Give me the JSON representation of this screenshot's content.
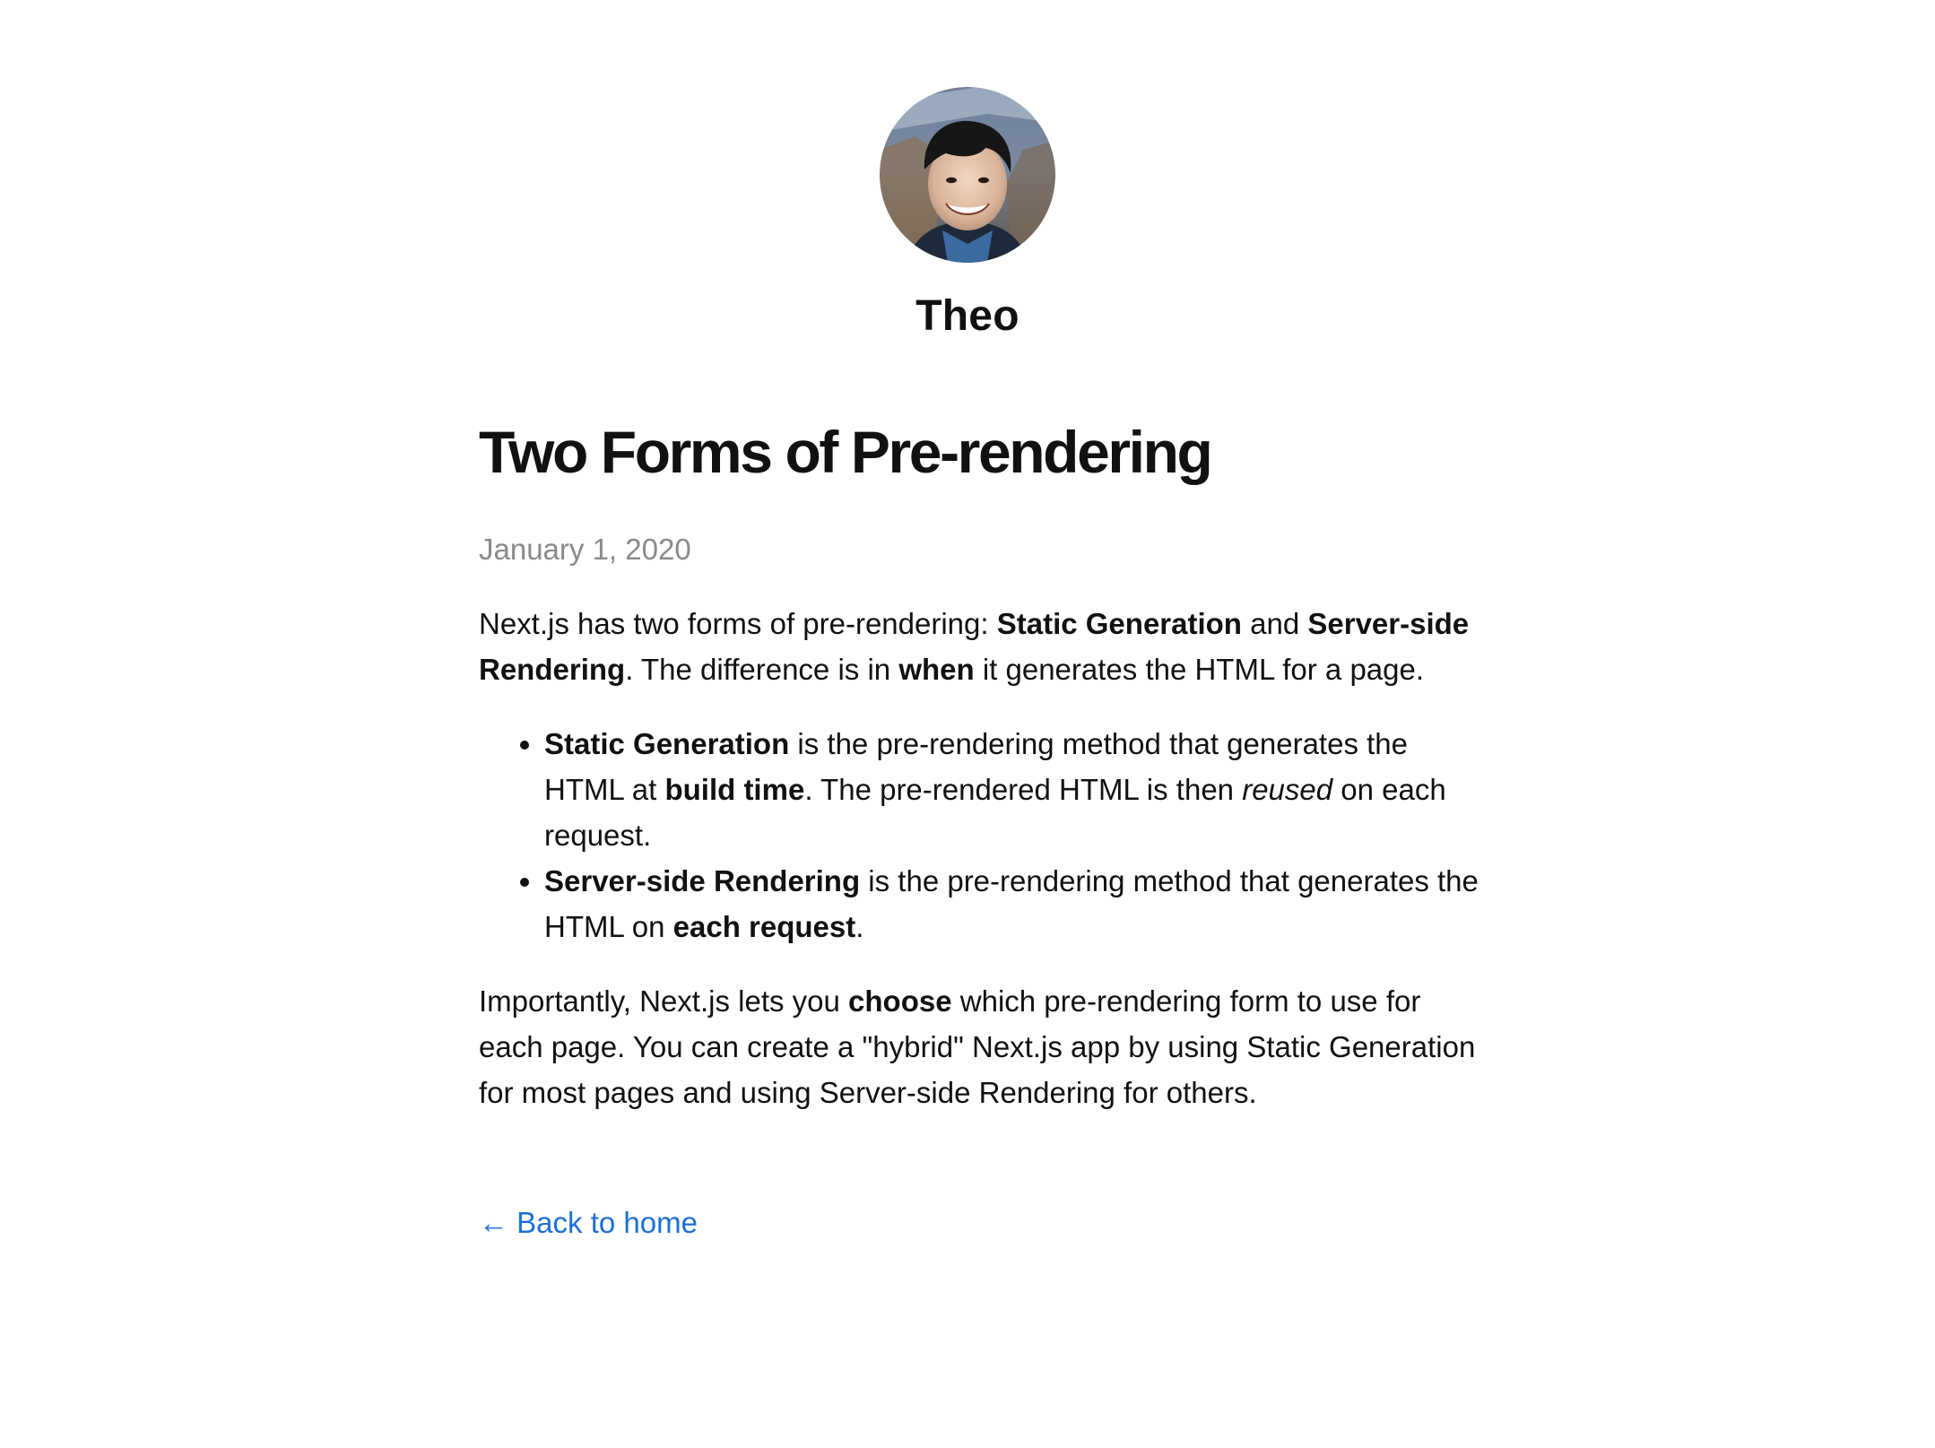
{
  "header": {
    "avatar_alt": "Theo",
    "site_name": "Theo"
  },
  "post": {
    "title": "Two Forms of Pre-rendering",
    "date": "January 1, 2020",
    "intro": {
      "t1": "Next.js has two forms of pre-rendering: ",
      "b1": "Static Generation",
      "t2": " and ",
      "b2": "Server-side Rendering",
      "t3": ". The difference is in ",
      "b3": "when",
      "t4": " it generates the HTML for a page."
    },
    "bullets": [
      {
        "b1": "Static Generation",
        "t1": " is the pre-rendering method that generates the HTML at ",
        "b2": "build time",
        "t2": ". The pre-rendered HTML is then ",
        "i1": "reused",
        "t3": " on each request."
      },
      {
        "b1": "Server-side Rendering",
        "t1": " is the pre-rendering method that generates the HTML on ",
        "b2": "each request",
        "t2": "."
      }
    ],
    "closing": {
      "t1": "Importantly, Next.js lets you ",
      "b1": "choose",
      "t2": " which pre-rendering form to use for each page. You can create a \"hybrid\" Next.js app by using Static Generation for most pages and using Server-side Rendering for others."
    }
  },
  "back_link": {
    "label": "← Back to home"
  }
}
